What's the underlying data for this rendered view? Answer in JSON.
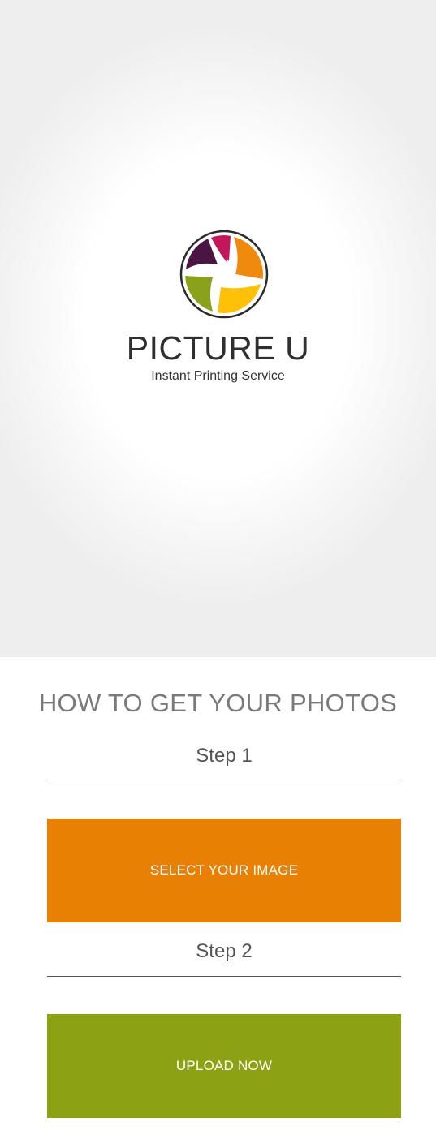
{
  "brand": {
    "name": "PICTURE U",
    "tagline": "Instant Printing Service",
    "logo_icon": "aperture-logo-icon",
    "logo_colors": [
      "#4b1543",
      "#c2185b",
      "#ef8a0c",
      "#ffc107",
      "#8aa21b"
    ]
  },
  "instructions": {
    "title": "HOW TO GET YOUR PHOTOS",
    "steps": [
      {
        "label": "Step 1",
        "button_label": "SELECT YOUR IMAGE",
        "button_color": "#e88003"
      },
      {
        "label": "Step 2",
        "button_label": "UPLOAD NOW",
        "button_color": "#8da212"
      }
    ]
  }
}
